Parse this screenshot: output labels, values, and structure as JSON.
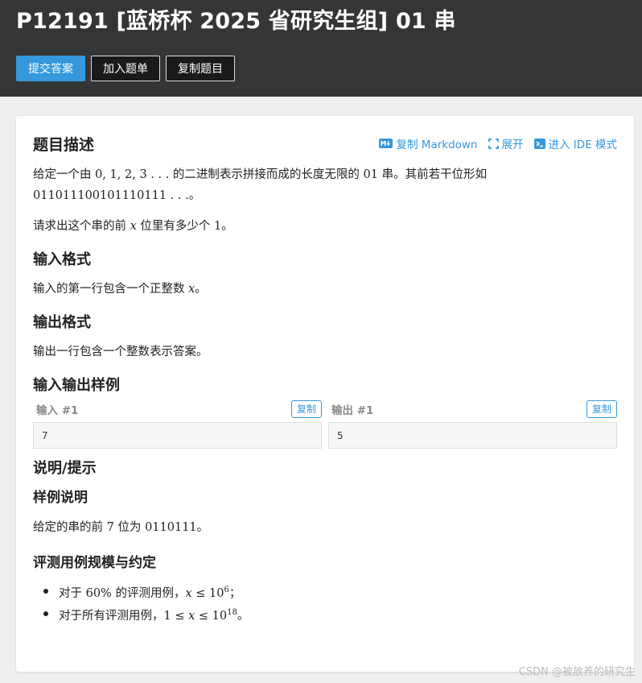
{
  "header": {
    "title": "P12191 [蓝桥杯 2025 省研究生组] 01 串",
    "buttons": {
      "submit": "提交答案",
      "add_list": "加入题单",
      "copy_problem": "复制题目"
    }
  },
  "card": {
    "title": "题目描述",
    "actions": {
      "copy_md": "复制 Markdown",
      "expand": "展开",
      "ide": "进入 IDE 模式"
    },
    "desc1_pre": "给定一个由 ",
    "desc1_math": "0, 1, 2, 3 . . .",
    "desc1_mid": " 的二进制表示拼接而成的长度无限的 ",
    "desc1_math2": "01",
    "desc1_post": " 串。其前若干位形如",
    "desc2_math": "011011100101110111 . . .",
    "desc2_post": "。",
    "desc3_pre": "请求出这个串的前 ",
    "desc3_var": "x",
    "desc3_mid": " 位里有多少个 ",
    "desc3_num": "1",
    "desc3_post": "。",
    "input_title": "输入格式",
    "input_pre": "输入的第一行包含一个正整数 ",
    "input_var": "x",
    "input_post": "。",
    "output_title": "输出格式",
    "output_text": "输出一行包含一个整数表示答案。",
    "samples_title": "输入输出样例",
    "sample_in_label": "输入 #1",
    "sample_out_label": "输出 #1",
    "copy_label": "复制",
    "sample_in": "7",
    "sample_out": "5",
    "hint_title": "说明/提示",
    "example_title": "样例说明",
    "example_pre": "给定的串的前 ",
    "example_num": "7",
    "example_mid": " 位为 ",
    "example_val": "0110111",
    "example_post": "。",
    "scale_title": "评测用例规模与约定",
    "bullet1_pre": "对于 ",
    "bullet1_pct": "60%",
    "bullet1_mid": " 的评测用例，",
    "bullet1_var": "x",
    "bullet1_le": " ≤ ",
    "bullet1_base": "10",
    "bullet1_exp": "6",
    "bullet1_post": "；",
    "bullet2_pre": "对于所有评测用例，",
    "bullet2_one": "1",
    "bullet2_le1": " ≤ ",
    "bullet2_var": "x",
    "bullet2_le2": " ≤ ",
    "bullet2_base": "10",
    "bullet2_exp": "18",
    "bullet2_post": "。"
  },
  "watermark": "CSDN @被放养的研究生",
  "colors": {
    "accent": "#3498db",
    "header_bg": "#343536"
  },
  "icons": [
    "markdown-icon",
    "expand-icon",
    "terminal-icon"
  ]
}
